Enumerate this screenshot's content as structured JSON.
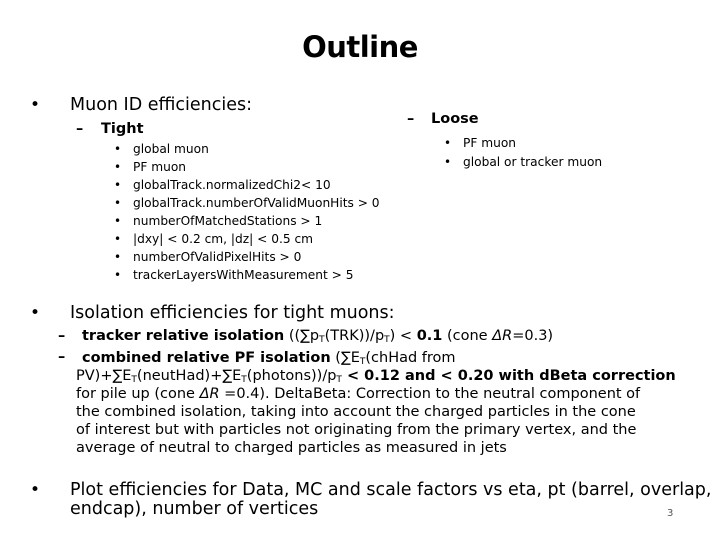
{
  "slide": {
    "title": "Outline",
    "page_number": "3",
    "bullet_char": "•",
    "dash_char": "–",
    "section_muon_id": {
      "label": "Muon ID efficiencies:",
      "tight": {
        "label": "Tight",
        "items": [
          "global muon",
          "PF muon",
          "globalTrack.normalizedChi2< 10",
          "globalTrack.numberOfValidMuonHits > 0",
          "numberOfMatchedStations > 1",
          "|dxy| < 0.2 cm, |dz| < 0.5 cm",
          "numberOfValidPixelHits > 0",
          "trackerLayersWithMeasurement > 5"
        ]
      },
      "loose": {
        "label": "Loose",
        "items": [
          "PF muon",
          "global or tracker muon"
        ]
      }
    },
    "section_isolation": {
      "label": "Isolation efficiencies for tight muons:",
      "tracker": {
        "bold_label": "tracker relative isolation",
        "formula_open": " ((∑p",
        "sub_T1": "T",
        "formula_mid": "(TRK))/p",
        "sub_T2": "T",
        "formula_close": ") < ",
        "cut": "0.1",
        "cone": " (cone ",
        "delta_r": "ΔR",
        "cone_value": "=0.3)"
      },
      "combined": {
        "bold_label": "combined relative PF isolation",
        "line1_open": " (∑E",
        "sub_T": "T",
        "line1_rest": "(chHad from",
        "line2_a": "PV)+∑E",
        "line2_b": "(neutHad)+∑E",
        "line2_c": "(photons))/p",
        "line2_bold": " < 0.12 and < 0.20 with dBeta correction",
        "line3_a": "for pile up (cone ",
        "line3_dr": "ΔR",
        "line3_b": " =0.4). DeltaBeta: Correction to the neutral component of",
        "line4": "the combined isolation, taking into account the charged particles in the cone",
        "line5": "of interest but with particles not originating from the primary vertex, and the",
        "line6": "average of neutral to charged particles as measured in jets"
      }
    },
    "section_plots": {
      "line1": "Plot efficiencies for Data, MC and scale factors vs eta, pt (barrel, overlap,",
      "line2": "endcap), number of vertices"
    }
  }
}
